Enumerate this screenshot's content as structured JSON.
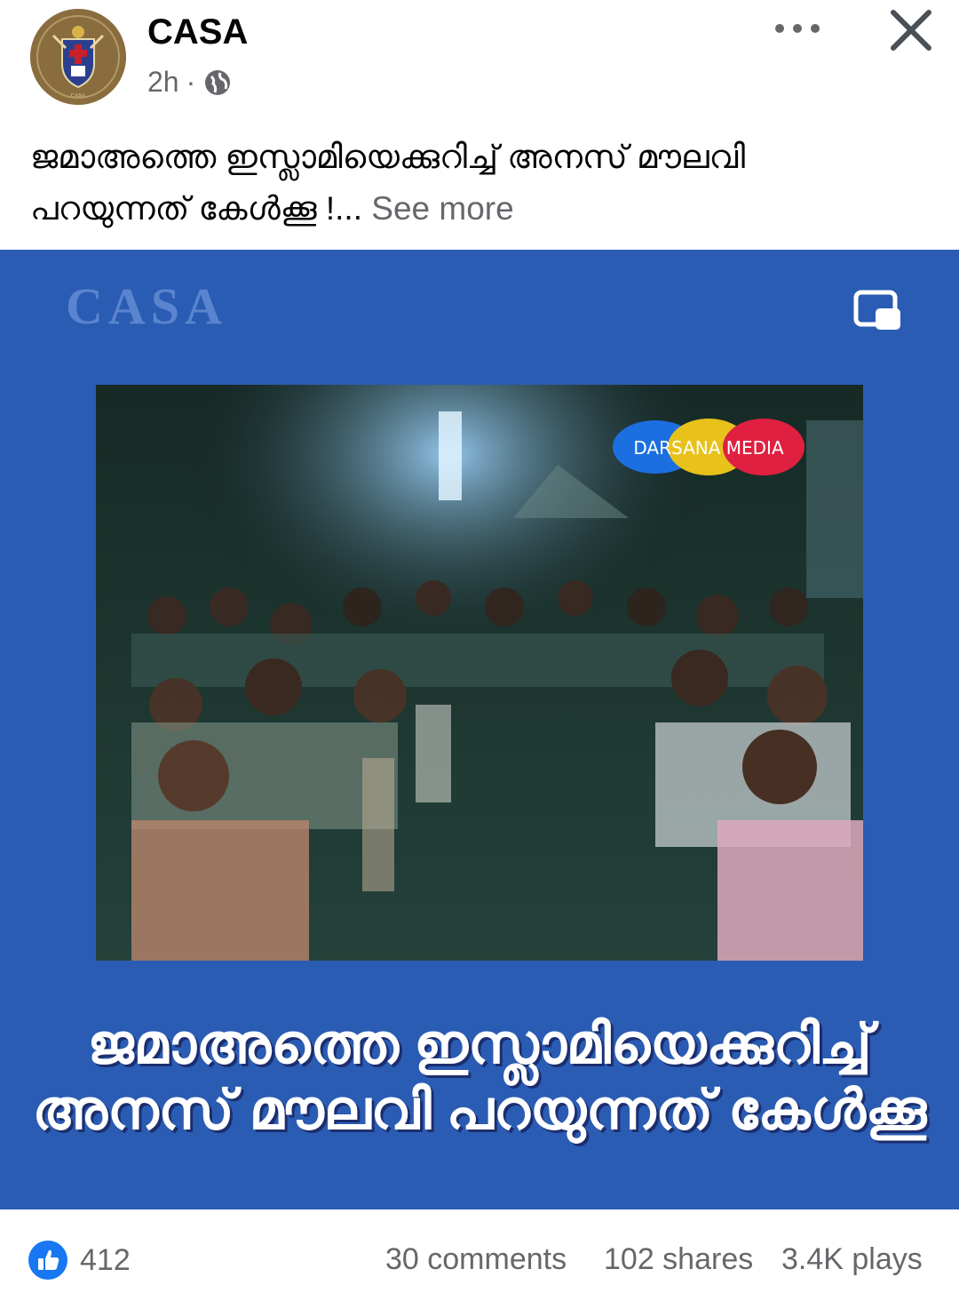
{
  "post": {
    "author": "CASA",
    "time": "2h",
    "caption_line1": "ജമാഅത്തെ ഇസ്ലാമിയെക്കുറിച്ച് അനസ് മൗലവി",
    "caption_line2": "പറയുന്നത് കേൾക്കൂ !...",
    "see_more": "See more"
  },
  "media": {
    "watermark": "CASA",
    "channel_logo_text": "DARSANA MEDIA",
    "overlay_line1": "ജമാഅത്തെ ഇസ്ലാമിയെക്കുറിച്ച്",
    "overlay_line2": "അനസ് മൗലവി പറയുന്നത് കേൾക്കൂ",
    "background_color": "#2a5cb3"
  },
  "stats": {
    "likes": "412",
    "comments": "30 comments",
    "shares": "102 shares",
    "plays": "3.4K plays"
  },
  "icons": {
    "avatar": "casa-crest-logo",
    "privacy": "globe-icon",
    "menu": "more-icon",
    "close": "close-icon",
    "pip": "picture-in-picture-icon",
    "reaction": "like-icon"
  },
  "colors": {
    "like_blue": "#1877f2",
    "secondary_text": "#65676b"
  }
}
